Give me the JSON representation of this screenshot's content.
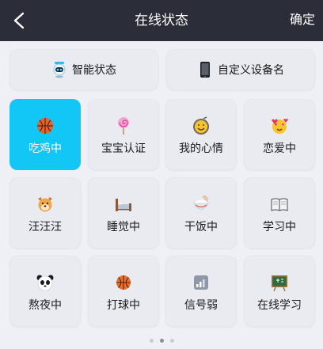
{
  "header": {
    "title": "在线状态",
    "confirm_label": "确定",
    "back_icon": "chevron-left-icon",
    "background": "#2b2e38"
  },
  "top_options": [
    {
      "label": "智能状态",
      "icon": "robot-icon"
    },
    {
      "label": "自定义设备名",
      "icon": "phone-icon"
    }
  ],
  "statuses": [
    {
      "label": "吃鸡中",
      "icon": "basketball-icon",
      "selected": true
    },
    {
      "label": "宝宝认证",
      "icon": "lollipop-icon",
      "selected": false
    },
    {
      "label": "我的心情",
      "icon": "smile-face-icon",
      "selected": false
    },
    {
      "label": "恋爱中",
      "icon": "heart-face-icon",
      "selected": false
    },
    {
      "label": "汪汪汪",
      "icon": "dog-icon",
      "selected": false
    },
    {
      "label": "睡觉中",
      "icon": "bed-icon",
      "selected": false
    },
    {
      "label": "干饭中",
      "icon": "rice-bowl-icon",
      "selected": false
    },
    {
      "label": "学习中",
      "icon": "book-icon",
      "selected": false
    },
    {
      "label": "熬夜中",
      "icon": "panda-icon",
      "selected": false
    },
    {
      "label": "打球中",
      "icon": "basketball-icon",
      "selected": false
    },
    {
      "label": "信号弱",
      "icon": "signal-icon",
      "selected": false
    },
    {
      "label": "在线学习",
      "icon": "chalkboard-icon",
      "selected": false
    }
  ],
  "pager": {
    "pages": 3,
    "current": 2
  },
  "colors": {
    "accent": "#12c6f5",
    "tile": "#e9ebf1",
    "page_bg": "#eef0f5"
  }
}
